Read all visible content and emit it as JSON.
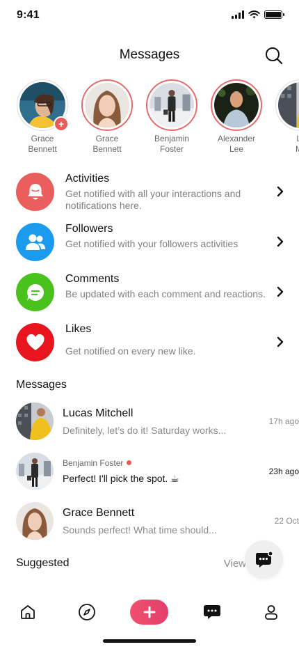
{
  "status_bar": {
    "time": "9:41"
  },
  "header": {
    "title": "Messages"
  },
  "stories": [
    {
      "name": "Grace\nBennett",
      "has_add_badge": true,
      "live": false
    },
    {
      "name": "Grace\nBennett",
      "has_add_badge": false,
      "live": true
    },
    {
      "name": "Benjamin\nFoster",
      "has_add_badge": false,
      "live": true
    },
    {
      "name": "Alexander\nLee",
      "has_add_badge": false,
      "live": true
    },
    {
      "name": "Lu\nMit",
      "has_add_badge": false,
      "live": false
    }
  ],
  "activity": [
    {
      "title": "Activities",
      "desc": "Get notified with all your interactions and notifications here.",
      "color": "#ea5e5e",
      "icon": "bell-icon"
    },
    {
      "title": "Followers",
      "desc": "Get notified with your followers activities",
      "color": "#1a9bf0",
      "icon": "users-icon"
    },
    {
      "title": "Comments",
      "desc": "Be updated with each comment and reactions.",
      "color": "#49c21d",
      "icon": "comment-icon"
    },
    {
      "title": "Likes",
      "desc": " Get notified on every new like.",
      "color": "#e8141e",
      "icon": "heart-icon"
    }
  ],
  "messages_title": "Messages",
  "messages": [
    {
      "name": "Lucas Mitchell",
      "preview": "Definitely, let’s do it! Saturday works...",
      "time": "17h ago",
      "unread": false
    },
    {
      "name": "Benjamin Foster",
      "preview": "Perfect! I'll pick the spot. ☕",
      "time": "23h ago",
      "unread": true
    },
    {
      "name": "Grace Bennett",
      "preview": "Sounds perfect! What time should...",
      "time": "22 Oct",
      "unread": false
    }
  ],
  "suggested": {
    "title": "Suggested",
    "view_all": "View"
  },
  "nav": {
    "active": "messages-tab",
    "accent": "#e8436b"
  }
}
